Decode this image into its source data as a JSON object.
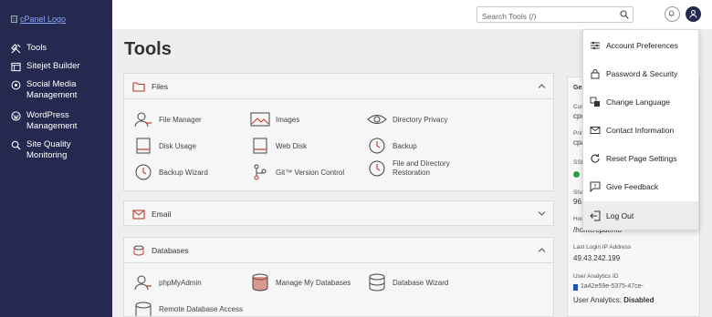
{
  "sidebar": {
    "logo_alt": "cPanel Logo",
    "items": [
      {
        "label": "Tools",
        "icon": "tools-icon"
      },
      {
        "label": "Sitejet Builder",
        "icon": "sitejet-icon"
      },
      {
        "label": "Social Media Management",
        "icon": "social-media-icon"
      },
      {
        "label": "WordPress Management",
        "icon": "wordpress-icon"
      },
      {
        "label": "Site Quality Monitoring",
        "icon": "site-quality-icon"
      }
    ]
  },
  "header": {
    "search_placeholder": "Search Tools (/)"
  },
  "main": {
    "title": "Tools",
    "files": {
      "title": "Files",
      "tools": [
        "File Manager",
        "Images",
        "Directory Privacy",
        "Disk Usage",
        "Web Disk",
        "Backup",
        "Backup Wizard",
        "Git™ Version Control",
        "File and Directory Restoration"
      ]
    },
    "email": {
      "title": "Email"
    },
    "databases": {
      "title": "Databases",
      "tools": [
        "phpMyAdmin",
        "Manage My Databases",
        "Database Wizard",
        "Remote Database Access"
      ]
    },
    "general": {
      "title_partial": "Gen",
      "labels_partial": [
        "Cur",
        "cpc",
        "Prim",
        "cpa",
        "SSL",
        "Sha",
        "96.",
        "Hon"
      ],
      "home_dir": "/home/cpdemo",
      "last_login_label": "Last Login IP Address",
      "last_login_ip": "49.43.242.199",
      "analytics_id_label": "User Analytics ID",
      "analytics_id": "1a42e59e-5375-47ce-",
      "analytics_status_label": "User Analytics:",
      "analytics_status": "Disabled"
    }
  },
  "user_menu": {
    "items": [
      {
        "label": "Account Preferences",
        "icon": "sliders-icon"
      },
      {
        "label": "Password & Security",
        "icon": "lock-icon"
      },
      {
        "label": "Change Language",
        "icon": "language-icon"
      },
      {
        "label": "Contact Information",
        "icon": "envelope-icon"
      },
      {
        "label": "Reset Page Settings",
        "icon": "reset-icon"
      },
      {
        "label": "Give Feedback",
        "icon": "feedback-icon"
      },
      {
        "label": "Log Out",
        "icon": "logout-icon"
      }
    ]
  },
  "colors": {
    "sidebar_bg": "#25294f",
    "overlay_bg": "#eeeeee",
    "menu_hover": "#ececec"
  }
}
